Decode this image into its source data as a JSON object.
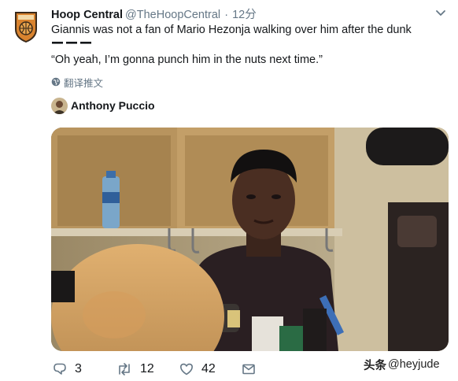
{
  "tweet": {
    "display_name": "Hoop Central",
    "handle": "@TheHoopCentral",
    "separator": "·",
    "time": "12分",
    "text_line1": "Giannis was not a fan of Mario Hezonja walking over him after the dunk",
    "text_line2": "“Oh yeah, I’m gonna punch him in the nuts next time.”",
    "translate_label": "翻译推文",
    "media_author": "Anthony Puccio"
  },
  "actions": {
    "replies": "3",
    "retweets": "12",
    "likes": "42"
  },
  "watermark": {
    "platform": "头条",
    "handle": "@heyjude"
  },
  "colors": {
    "text_primary": "#14171a",
    "text_secondary": "#657786",
    "logo_orange": "#d9832e"
  },
  "icons": [
    "hoop-central-logo",
    "chevron-down-icon",
    "globe-icon",
    "reply-icon",
    "retweet-icon",
    "like-icon",
    "message-icon"
  ]
}
